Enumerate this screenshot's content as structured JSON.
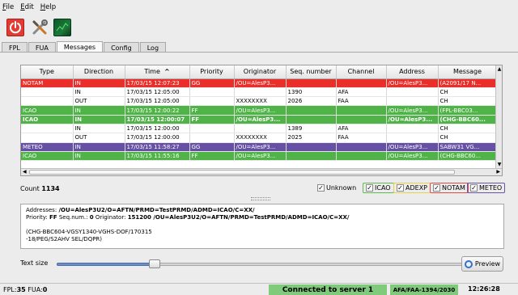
{
  "menu": [
    "File",
    "Edit",
    "Help"
  ],
  "tabs": [
    {
      "label": "FPL",
      "active": false
    },
    {
      "label": "FUA",
      "active": false
    },
    {
      "label": "Messages",
      "active": true
    },
    {
      "label": "Config",
      "active": false
    },
    {
      "label": "Log",
      "active": false
    }
  ],
  "table": {
    "columns": [
      "Type",
      "Direction",
      "Time",
      "Priority",
      "Originator",
      "Seq. number",
      "Channel",
      "Address",
      "Message"
    ],
    "sort_indicator": "^",
    "rows": [
      {
        "style": "red",
        "bold": false,
        "cells": [
          "NOTAM",
          "IN",
          "17/03/15 12:07:23",
          "GG",
          "/OU=AlesP3...",
          "",
          "",
          "/OU=AlesP3...",
          "(A2091/17 N..."
        ]
      },
      {
        "style": "plain",
        "bold": false,
        "cells": [
          "",
          "IN",
          "17/03/15 12:05:00",
          "",
          "",
          "1390",
          "AFA",
          "",
          "CH"
        ]
      },
      {
        "style": "plain",
        "bold": false,
        "cells": [
          "",
          "OUT",
          "17/03/15 12:05:00",
          "",
          "XXXXXXXX",
          "2026",
          "FAA",
          "",
          "CH"
        ]
      },
      {
        "style": "green",
        "bold": false,
        "cells": [
          "ICAO",
          "IN",
          "17/03/15 12:00:22",
          "FF",
          "/OU=AlesP3...",
          "",
          "",
          "/OU=AlesP3...",
          "(FPL-BBC03..."
        ]
      },
      {
        "style": "green",
        "bold": true,
        "cells": [
          "ICAO",
          "IN",
          "17/03/15 12:00:07",
          "FF",
          "/OU=AlesP3...",
          "",
          "",
          "/OU=AlesP3...",
          "(CHG-BBC60..."
        ]
      },
      {
        "style": "plain",
        "bold": false,
        "cells": [
          "",
          "IN",
          "17/03/15 12:00:00",
          "",
          "",
          "1389",
          "AFA",
          "",
          "CH"
        ]
      },
      {
        "style": "plain",
        "bold": false,
        "cells": [
          "",
          "OUT",
          "17/03/15 12:00:00",
          "",
          "XXXXXXXX",
          "2025",
          "FAA",
          "",
          "CH"
        ]
      },
      {
        "style": "purple",
        "bold": false,
        "cells": [
          "METEO",
          "IN",
          "17/03/15 11:58:27",
          "GG",
          "/OU=AlesP3...",
          "",
          "",
          "/OU=AlesP3...",
          "SABW31 VG..."
        ]
      },
      {
        "style": "green",
        "bold": false,
        "cells": [
          "ICAO",
          "IN",
          "17/03/15 11:55:16",
          "FF",
          "/OU=AlesP3...",
          "",
          "",
          "/OU=AlesP3...",
          "(CHG-BBC60..."
        ]
      }
    ]
  },
  "count": {
    "label": "Count",
    "value": "1134"
  },
  "filters": [
    {
      "label": "Unknown",
      "checked": true
    },
    {
      "label": "ICAO",
      "checked": true
    },
    {
      "label": "ADEXP",
      "checked": true
    },
    {
      "label": "NOTAM",
      "checked": true
    },
    {
      "label": "METEO",
      "checked": true
    }
  ],
  "detail": {
    "addresses_label": "Addresses:",
    "addresses_value": "/OU=AlesP3U2/O=AFTN/PRMD=TestPRMD/ADMD=ICAO/C=XX/",
    "priority_label": "Priority:",
    "priority_value": "FF",
    "seq_label": "Seq.num.:",
    "seq_value": "0",
    "originator_label": "Originator:",
    "originator_value": "151200 /OU=AlesP3U2/O=AFTN/PRMD=TestPRMD/ADMD=ICAO/C=XX/",
    "body_line1": "(CHG-BBC604-VGSY1340-VGHS-DOF/170315",
    "body_line2": "-18/PEG/S2AHV SEL/DQPR)"
  },
  "text_size": {
    "label": "Text size",
    "level_fraction": 0.23
  },
  "preview_label": "Preview",
  "status": {
    "fpl_label": "FPL:",
    "fpl_value": "35",
    "fua_label": "FUA:",
    "fua_value": "0",
    "connection": "Connected to server 1",
    "afa_faa": "AFA/FAA-1394/2030",
    "clock": "12:26:28"
  },
  "colors": {
    "notam": "#ea2e2a",
    "icao": "#4fb348",
    "meteo": "#6550a6",
    "connected": "#7fca7b"
  },
  "icons": [
    "power-icon",
    "tools-icon",
    "radar-icon",
    "sort-ascending-icon",
    "magnifier-icon"
  ]
}
